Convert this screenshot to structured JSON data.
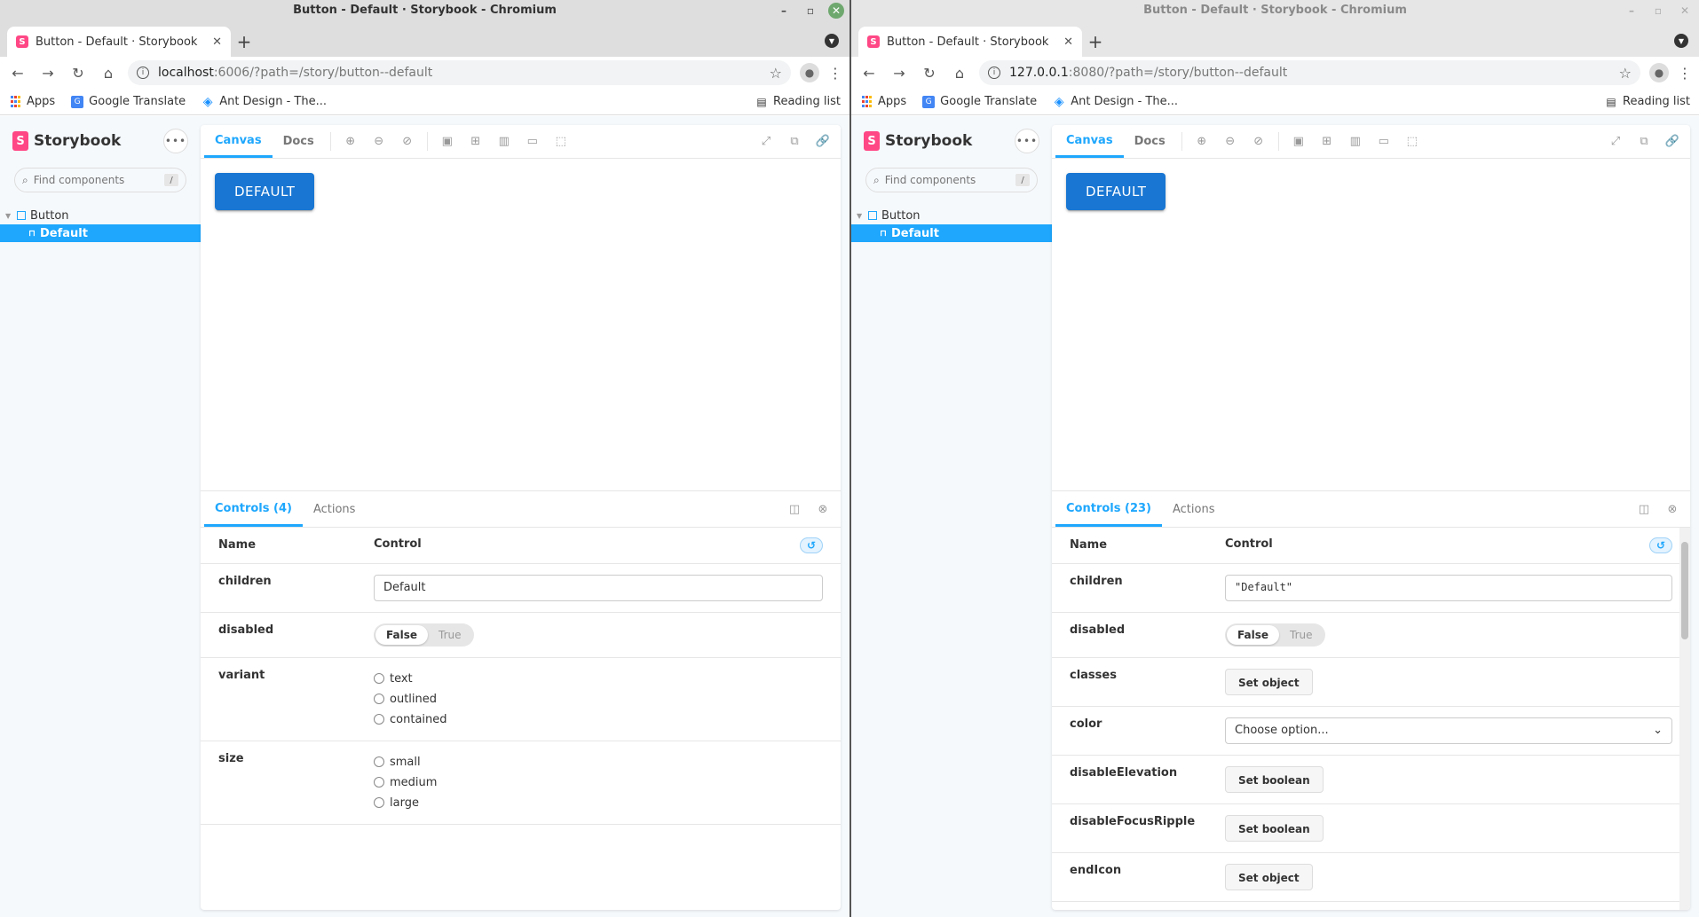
{
  "left": {
    "window_title": "Button - Default · Storybook - Chromium",
    "tab_title": "Button - Default · Storybook",
    "url_host": "localhost",
    "url_path": ":6006/?path=/story/button--default",
    "bookmarks": [
      "Apps",
      "Google Translate",
      "Ant Design - The..."
    ],
    "reading_list": "Reading list",
    "sidebar": {
      "brand": "Storybook",
      "search_placeholder": "Find components",
      "search_shortcut": "/",
      "group": "Button",
      "story": "Default"
    },
    "toolbar_tabs": [
      "Canvas",
      "Docs"
    ],
    "preview_button": "DEFAULT",
    "addon_tabs": [
      "Controls (4)",
      "Actions"
    ],
    "controls_header": {
      "name": "Name",
      "control": "Control"
    },
    "controls": {
      "children": {
        "name": "children",
        "value": "Default"
      },
      "disabled": {
        "name": "disabled",
        "off": "False",
        "on": "True"
      },
      "variant": {
        "name": "variant",
        "options": [
          "text",
          "outlined",
          "contained"
        ]
      },
      "size": {
        "name": "size",
        "options": [
          "small",
          "medium",
          "large"
        ]
      }
    }
  },
  "right": {
    "window_title": "Button - Default · Storybook - Chromium",
    "tab_title": "Button - Default · Storybook",
    "url_host": "127.0.0.1",
    "url_path": ":8080/?path=/story/button--default",
    "bookmarks": [
      "Apps",
      "Google Translate",
      "Ant Design - The..."
    ],
    "reading_list": "Reading list",
    "sidebar": {
      "brand": "Storybook",
      "search_placeholder": "Find components",
      "search_shortcut": "/",
      "group": "Button",
      "story": "Default"
    },
    "toolbar_tabs": [
      "Canvas",
      "Docs"
    ],
    "preview_button": "DEFAULT",
    "addon_tabs": [
      "Controls (23)",
      "Actions"
    ],
    "controls_header": {
      "name": "Name",
      "control": "Control"
    },
    "controls": {
      "children": {
        "name": "children",
        "value": "\"Default\""
      },
      "disabled": {
        "name": "disabled",
        "off": "False",
        "on": "True"
      },
      "classes": {
        "name": "classes",
        "button": "Set object"
      },
      "color": {
        "name": "color",
        "placeholder": "Choose option..."
      },
      "disableElevation": {
        "name": "disableElevation",
        "button": "Set boolean"
      },
      "disableFocusRipple": {
        "name": "disableFocusRipple",
        "button": "Set boolean"
      },
      "endIcon": {
        "name": "endIcon",
        "button": "Set object"
      }
    }
  },
  "colors": {
    "storybook_accent": "#1ea7fd",
    "storybook_brand": "#ff4785",
    "mui_primary": "#1976d2"
  }
}
